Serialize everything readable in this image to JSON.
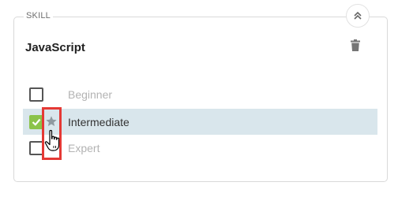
{
  "section": {
    "legend": "SKILL",
    "collapse_icon": "chevron-double-up-icon",
    "delete_icon": "trash-icon"
  },
  "skill": {
    "name": "JavaScript"
  },
  "levels": [
    {
      "label": "Beginner",
      "checked": false
    },
    {
      "label": "Intermediate",
      "checked": true,
      "starred": true
    },
    {
      "label": "Expert",
      "checked": false
    }
  ],
  "colors": {
    "check_green": "#8bc34a",
    "selected_row": "#d9e6ec",
    "highlight_red": "#e53935"
  }
}
